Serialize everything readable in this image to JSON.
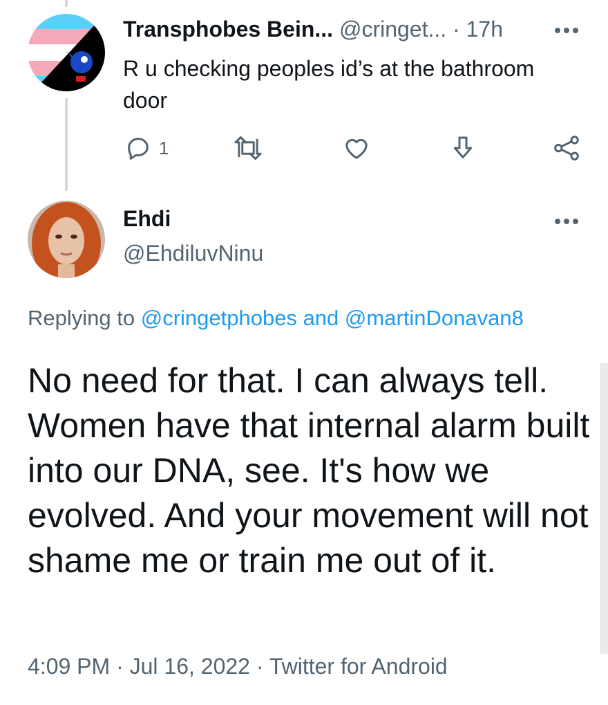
{
  "reply": {
    "display_name": "Transphobes Bein...",
    "handle": "@cringet...",
    "time": "· 17h",
    "text": "R u checking peoples id’s at the bathroom\ndoor",
    "reply_count": "1",
    "icons": [
      "reply-icon",
      "retweet-icon",
      "like-icon",
      "download-icon",
      "share-icon",
      "more-icon"
    ]
  },
  "main": {
    "display_name": "Ehdi",
    "handle": "@EhdiluvNinu",
    "replying_prefix": "Replying to",
    "replying_user1": "@cringetphobes",
    "replying_and": "and",
    "replying_user2": "@martinDonavan8",
    "text": "No need for that. I can always tell. Women have that internal alarm built into our DNA, see. It's how we evolved. And your movement will not shame me or train me out of it.",
    "timestamp": "4:09 PM · Jul 16, 2022 · Twitter for Android"
  },
  "colors": {
    "link": "#1d9bf0",
    "muted": "#536471",
    "text": "#0f1419",
    "thread_line": "#cfd9de"
  }
}
